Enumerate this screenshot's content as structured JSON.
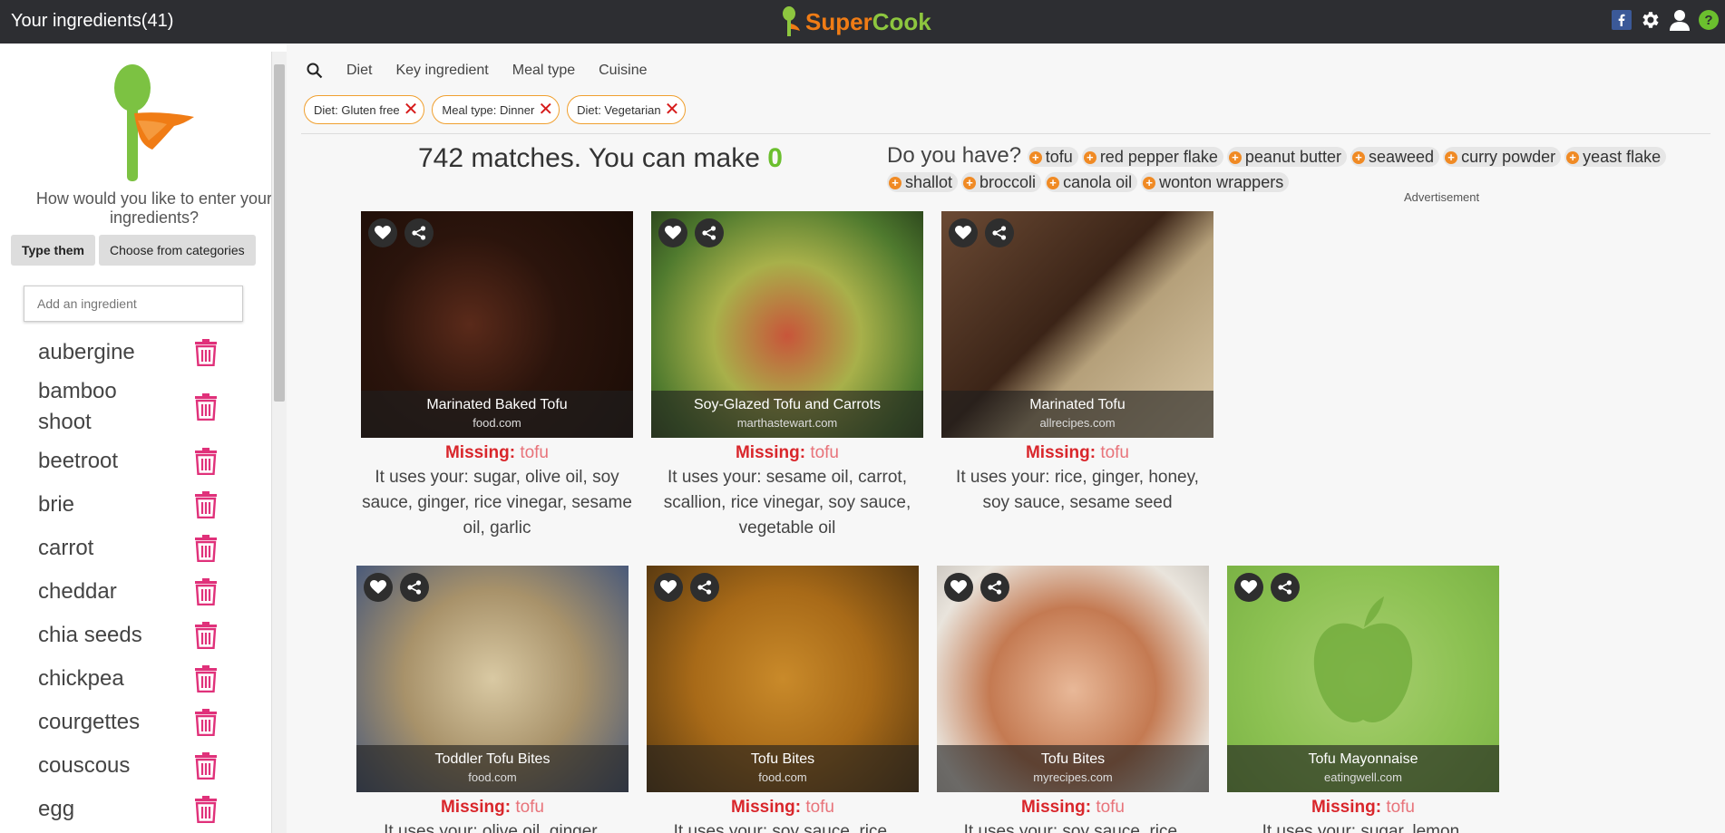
{
  "sidebar": {
    "title": "Your ingredients(41)",
    "prompt": "How would you like to enter your ingredients?",
    "mode_type": "Type them",
    "mode_categories": "Choose from categories",
    "add_placeholder": "Add an ingredient",
    "ingredients": [
      "aubergine",
      "bamboo shoot",
      "beetroot",
      "brie",
      "carrot",
      "cheddar",
      "chia seeds",
      "chickpea",
      "courgettes",
      "couscous",
      "egg"
    ]
  },
  "header": {
    "brand_super": "Super",
    "brand_cook": "Cook"
  },
  "filters": {
    "tabs": [
      "Diet",
      "Key ingredient",
      "Meal type",
      "Cuisine"
    ],
    "chips": [
      "Diet: Gluten free",
      "Meal type: Dinner",
      "Diet: Vegetarian"
    ]
  },
  "results": {
    "matches_text": "742 matches. You can make",
    "can_make": "0",
    "do_you_have": "Do you have?",
    "suggestions": [
      "tofu",
      "red pepper flake",
      "peanut butter",
      "seaweed",
      "curry powder",
      "yeast flake",
      "shallot",
      "broccoli",
      "canola oil",
      "wonton wrappers"
    ],
    "advertisement": "Advertisement",
    "missing_label": "Missing:",
    "recipes": [
      {
        "title": "Marinated Baked Tofu",
        "source": "food.com",
        "missing": "tofu",
        "uses": "It uses your: sugar, olive oil, soy sauce, ginger, rice vinegar, sesame oil, garlic"
      },
      {
        "title": "Soy-Glazed Tofu and Carrots",
        "source": "marthastewart.com",
        "missing": "tofu",
        "uses": "It uses your: sesame oil, carrot, scallion, rice vinegar, soy sauce, vegetable oil"
      },
      {
        "title": "Marinated Tofu",
        "source": "allrecipes.com",
        "missing": "tofu",
        "uses": "It uses your: rice, ginger, honey, soy sauce, sesame seed"
      },
      {
        "title": "Toddler Tofu Bites",
        "source": "food.com",
        "missing": "tofu",
        "uses": "It uses your: olive oil, ginger,"
      },
      {
        "title": "Tofu Bites",
        "source": "food.com",
        "missing": "tofu",
        "uses": "It uses your: soy sauce, rice,"
      },
      {
        "title": "Tofu Bites",
        "source": "myrecipes.com",
        "missing": "tofu",
        "uses": "It uses your: soy sauce, rice,"
      },
      {
        "title": "Tofu Mayonnaise",
        "source": "eatingwell.com",
        "missing": "tofu",
        "uses": "It uses your: sugar, lemon,"
      }
    ]
  },
  "colors": {
    "accent": "#f07c15",
    "green": "#6bbf2e",
    "missing": "#d9262b",
    "trash": "#e0317a"
  }
}
